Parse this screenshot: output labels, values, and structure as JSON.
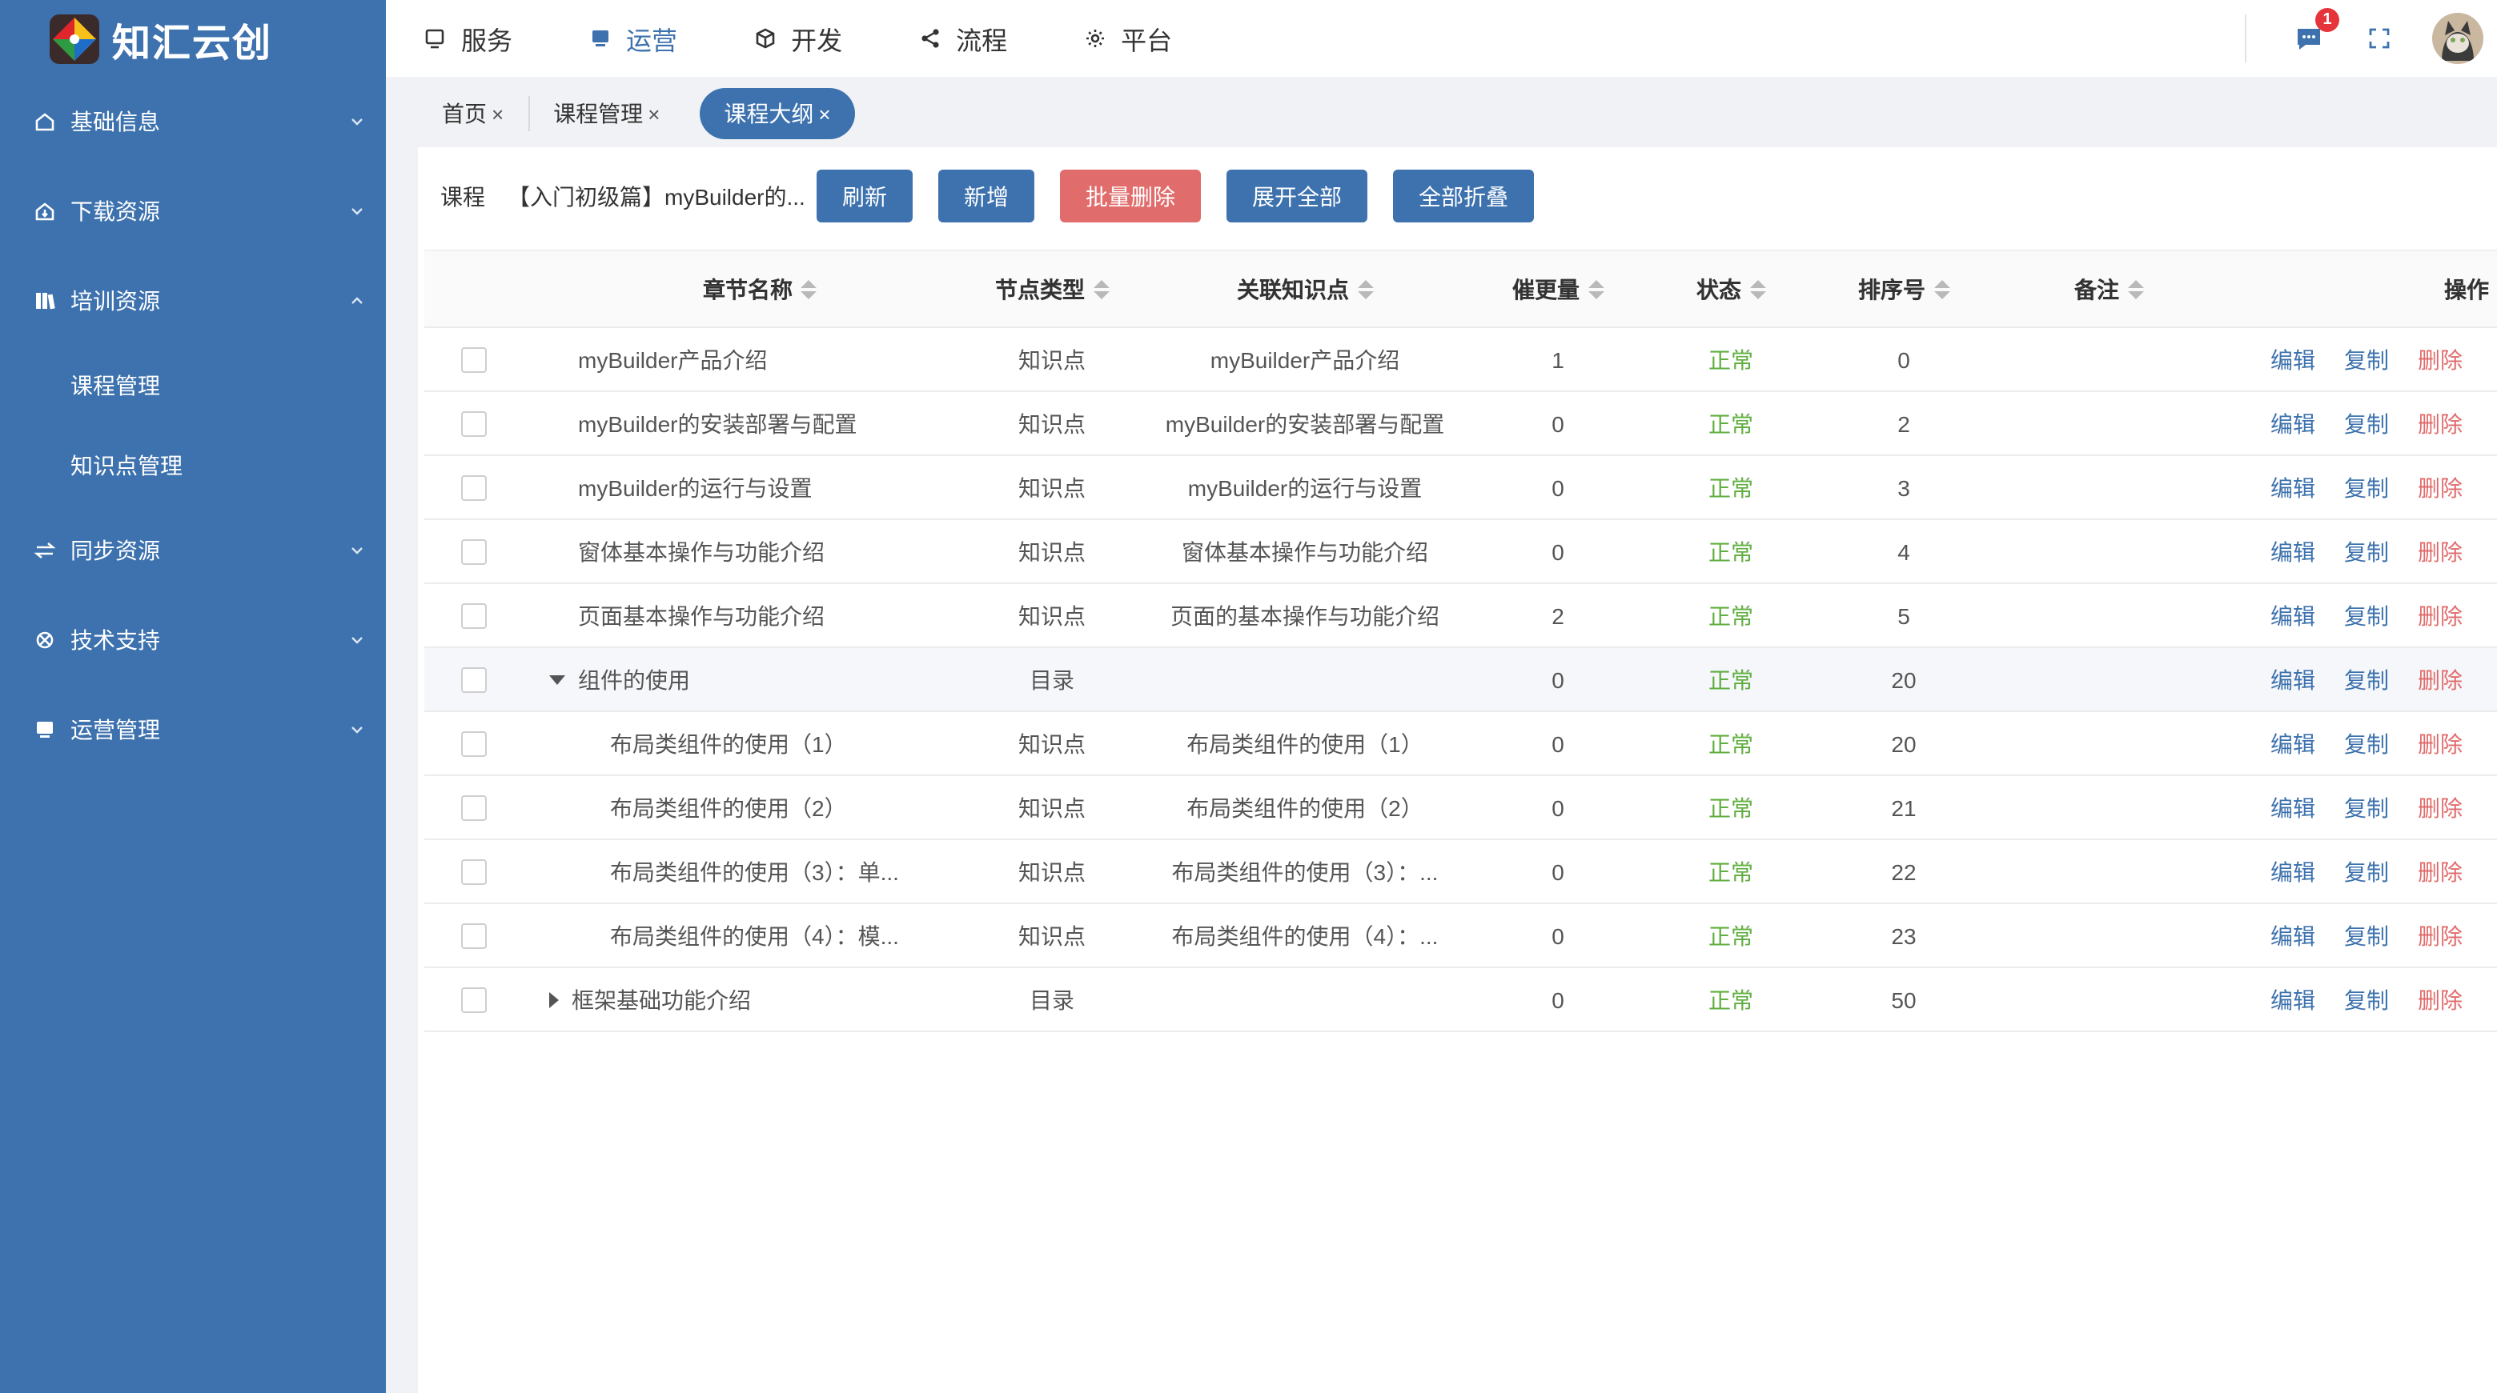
{
  "app": {
    "title": "知汇云创"
  },
  "sidebar": {
    "items": [
      {
        "label": "基础信息",
        "icon": "house-icon",
        "expanded": false
      },
      {
        "label": "下载资源",
        "icon": "download-house-icon",
        "expanded": false
      },
      {
        "label": "培训资源",
        "icon": "book-icon",
        "expanded": true,
        "children": [
          {
            "label": "课程管理"
          },
          {
            "label": "知识点管理"
          }
        ]
      },
      {
        "label": "同步资源",
        "icon": "sync-icon",
        "expanded": false
      },
      {
        "label": "技术支持",
        "icon": "support-icon",
        "expanded": false
      },
      {
        "label": "运营管理",
        "icon": "monitor-icon",
        "expanded": false
      }
    ]
  },
  "topnav": {
    "items": [
      {
        "label": "服务",
        "icon": "service-icon",
        "active": false
      },
      {
        "label": "运营",
        "icon": "operation-icon",
        "active": true
      },
      {
        "label": "开发",
        "icon": "cube-icon",
        "active": false
      },
      {
        "label": "流程",
        "icon": "share-icon",
        "active": false
      },
      {
        "label": "平台",
        "icon": "gear-icon",
        "active": false
      }
    ],
    "message_badge": "1"
  },
  "tabs": [
    {
      "label": "首页",
      "close": "×",
      "active": false
    },
    {
      "label": "课程管理",
      "close": "×",
      "active": false
    },
    {
      "label": "课程大纲",
      "close": "×",
      "active": true
    }
  ],
  "toolbar": {
    "course_label": "课程",
    "course_value": "【入门初级篇】myBuilder的...",
    "buttons": {
      "refresh": "刷新",
      "add": "新增",
      "batch_delete": "批量删除",
      "expand_all": "展开全部",
      "collapse_all": "全部折叠"
    }
  },
  "table": {
    "headers": {
      "name": "章节名称",
      "type": "节点类型",
      "knowledge": "关联知识点",
      "qty": "催更量",
      "status": "状态",
      "order": "排序号",
      "note": "备注",
      "ops": "操作"
    },
    "ops": {
      "edit": "编辑",
      "copy": "复制",
      "delete": "删除"
    },
    "rows": [
      {
        "name": "myBuilder产品介绍",
        "type": "知识点",
        "knowledge": "myBuilder产品介绍",
        "qty": "1",
        "status": "正常",
        "order": "0",
        "note": ""
      },
      {
        "name": "myBuilder的安装部署与配置",
        "type": "知识点",
        "knowledge": "myBuilder的安装部署与配置",
        "qty": "0",
        "status": "正常",
        "order": "2",
        "note": ""
      },
      {
        "name": "myBuilder的运行与设置",
        "type": "知识点",
        "knowledge": "myBuilder的运行与设置",
        "qty": "0",
        "status": "正常",
        "order": "3",
        "note": ""
      },
      {
        "name": "窗体基本操作与功能介绍",
        "type": "知识点",
        "knowledge": "窗体基本操作与功能介绍",
        "qty": "0",
        "status": "正常",
        "order": "4",
        "note": ""
      },
      {
        "name": "页面基本操作与功能介绍",
        "type": "知识点",
        "knowledge": "页面的基本操作与功能介绍",
        "qty": "2",
        "status": "正常",
        "order": "5",
        "note": ""
      },
      {
        "name": "组件的使用",
        "type": "目录",
        "knowledge": "",
        "qty": "0",
        "status": "正常",
        "order": "20",
        "note": "",
        "tree": "expanded"
      },
      {
        "name": "布局类组件的使用（1）",
        "type": "知识点",
        "knowledge": "布局类组件的使用（1）",
        "qty": "0",
        "status": "正常",
        "order": "20",
        "note": "",
        "child": true
      },
      {
        "name": "布局类组件的使用（2）",
        "type": "知识点",
        "knowledge": "布局类组件的使用（2）",
        "qty": "0",
        "status": "正常",
        "order": "21",
        "note": "",
        "child": true
      },
      {
        "name": "布局类组件的使用（3）：单...",
        "type": "知识点",
        "knowledge": "布局类组件的使用（3）：...",
        "qty": "0",
        "status": "正常",
        "order": "22",
        "note": "",
        "child": true
      },
      {
        "name": "布局类组件的使用（4）：模...",
        "type": "知识点",
        "knowledge": "布局类组件的使用（4）：...",
        "qty": "0",
        "status": "正常",
        "order": "23",
        "note": "",
        "child": true
      },
      {
        "name": "框架基础功能介绍",
        "type": "目录",
        "knowledge": "",
        "qty": "0",
        "status": "正常",
        "order": "50",
        "note": "",
        "tree": "collapsed"
      }
    ]
  },
  "colors": {
    "brand": "#3d72ae",
    "danger": "#e16c6c",
    "success": "#5fae3f"
  }
}
